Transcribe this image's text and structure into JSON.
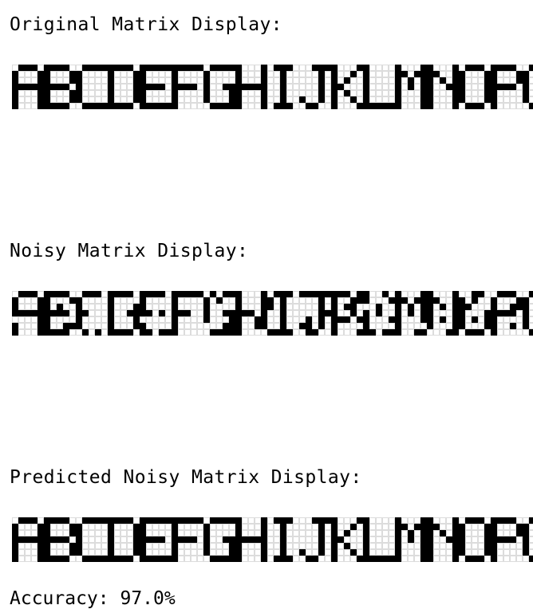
{
  "sections": [
    {
      "id": "original",
      "title": "Original Matrix Display:",
      "letters": "ABCDEFGHIJKLMNOPQ"
    },
    {
      "id": "noisy",
      "title": "Noisy Matrix Display:",
      "letters": "ABCDEFGHIJKLMNOPQ"
    },
    {
      "id": "predicted",
      "title": "Predicted Noisy Matrix Display:",
      "letters": "ABCDEFGHIJKLMNOPQ"
    }
  ],
  "accuracy_text": "Accuracy: 97.0%",
  "colors": {
    "pixel_on": "#000000",
    "pixel_off": "#ffffff",
    "grid_line": "#dcdcdc"
  }
}
